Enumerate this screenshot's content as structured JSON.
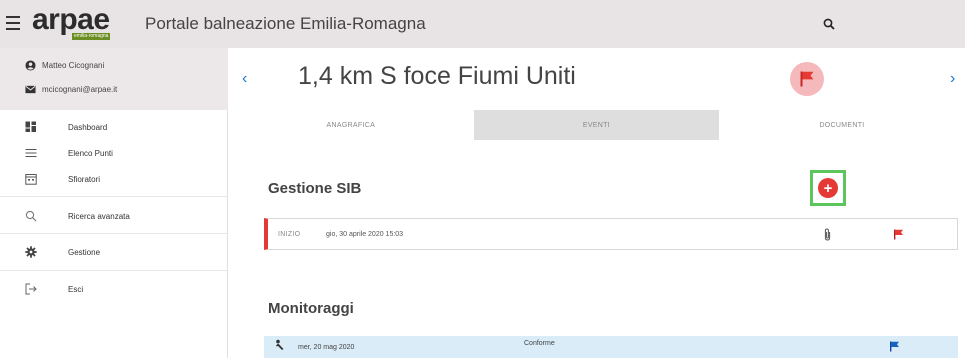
{
  "header": {
    "logo_text": "arpae",
    "logo_sub": "emilia-romagna",
    "title": "Portale balneazione Emilia-Romagna",
    "menu_icon": "hamburger-menu-icon",
    "search_icon": "search-icon"
  },
  "user": {
    "name": "Matteo Cicognani",
    "email": "mcicognani@arpae.it"
  },
  "sidebar": {
    "items": [
      {
        "label": "Dashboard",
        "icon": "dashboard-icon"
      },
      {
        "label": "Elenco Punti",
        "icon": "list-icon"
      },
      {
        "label": "Sfioratori",
        "icon": "calendar-icon"
      },
      {
        "label": "Ricerca avanzata",
        "icon": "search-icon"
      },
      {
        "label": "Gestione",
        "icon": "gear-icon"
      },
      {
        "label": "Esci",
        "icon": "logout-icon"
      }
    ]
  },
  "point": {
    "title": "1,4 km S foce Fiumi Uniti",
    "status_color": "#e53935",
    "prev_label": "‹",
    "next_label": "›"
  },
  "tabs": [
    {
      "label": "ANAGRAFICA",
      "active": false
    },
    {
      "label": "EVENTI",
      "active": true
    },
    {
      "label": "DOCUMENTI",
      "active": false
    }
  ],
  "sib": {
    "title": "Gestione SIB",
    "add_label": "+",
    "event": {
      "tag": "INIZIO",
      "date": "gio, 30 aprile 2020 15:03",
      "flag_color": "#e53935"
    }
  },
  "monitoraggi": {
    "title": "Monitoraggi",
    "row": {
      "date": "mer, 20 mag 2020",
      "status": "Conforme",
      "flag_color": "#1565c0"
    }
  },
  "colors": {
    "accent_blue": "#1976d2",
    "highlight_green": "#5cc65c",
    "alert_red": "#e53935"
  }
}
